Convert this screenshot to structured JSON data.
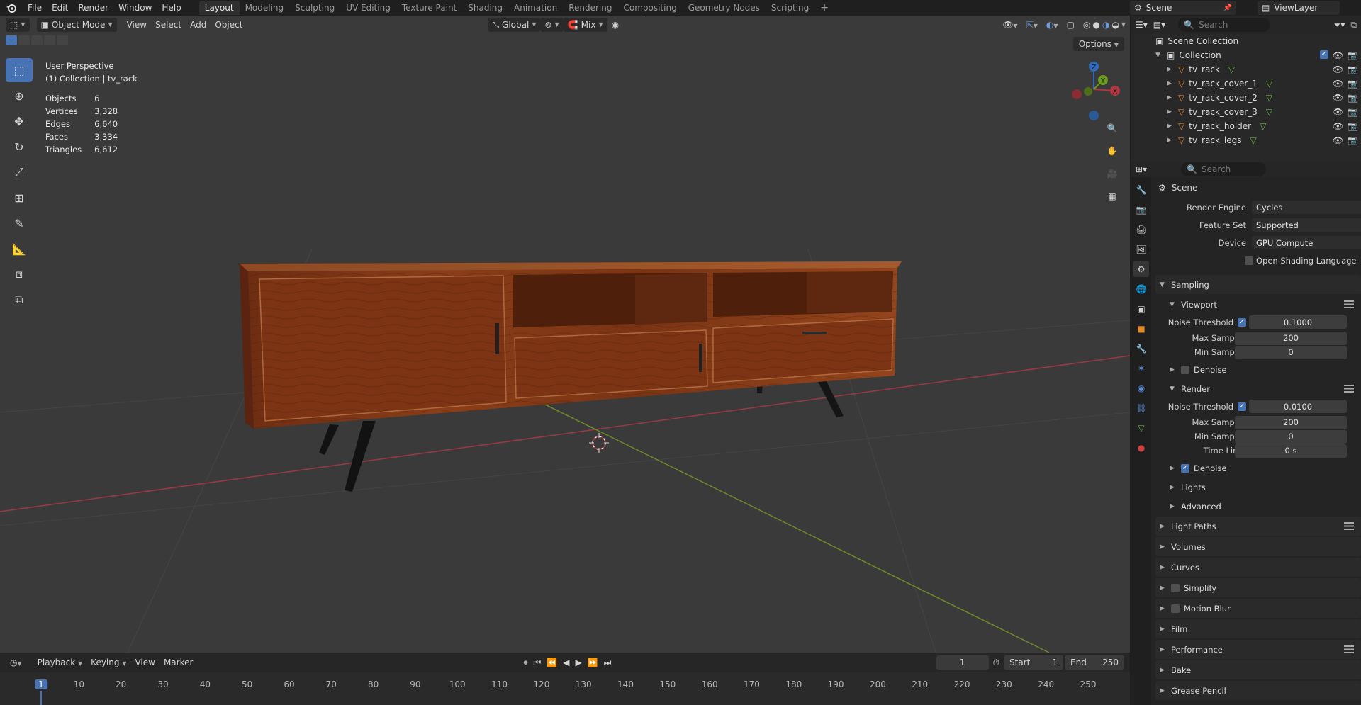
{
  "topbar": {
    "menus": [
      "File",
      "Edit",
      "Render",
      "Window",
      "Help"
    ],
    "workspaces": [
      "Layout",
      "Modeling",
      "Sculpting",
      "UV Editing",
      "Texture Paint",
      "Shading",
      "Animation",
      "Rendering",
      "Compositing",
      "Geometry Nodes",
      "Scripting"
    ],
    "active_workspace": "Layout",
    "add_workspace": "+",
    "scene_name": "Scene",
    "view_layer": "ViewLayer"
  },
  "viewport": {
    "mode": "Object Mode",
    "menus": [
      "View",
      "Select",
      "Add",
      "Object"
    ],
    "transform_orientation": "Global",
    "snap_mode": "Mix",
    "options_label": "Options",
    "perspective_label": "User Perspective",
    "collection_label": "(1) Collection | tv_rack",
    "stats": [
      {
        "label": "Objects",
        "value": "6"
      },
      {
        "label": "Vertices",
        "value": "3,328"
      },
      {
        "label": "Edges",
        "value": "6,640"
      },
      {
        "label": "Faces",
        "value": "3,334"
      },
      {
        "label": "Triangles",
        "value": "6,612"
      }
    ],
    "gizmo_axes": {
      "z": "Z",
      "y": "Y",
      "x": "X"
    },
    "colors": {
      "x_axis": "#9b3a44",
      "y_axis": "#6d8a2a",
      "bg": "#3a3a3a",
      "active_tool": "#4772b3"
    }
  },
  "timeline": {
    "menus": [
      "Playback",
      "Keying",
      "View",
      "Marker"
    ],
    "current_frame": "1",
    "start_label": "Start",
    "start_value": "1",
    "end_label": "End",
    "end_value": "250",
    "ticks": [
      "1",
      "10",
      "20",
      "30",
      "40",
      "50",
      "60",
      "70",
      "80",
      "90",
      "100",
      "110",
      "120",
      "130",
      "140",
      "150",
      "160",
      "170",
      "180",
      "190",
      "200",
      "210",
      "220",
      "230",
      "240",
      "250"
    ]
  },
  "outliner": {
    "search_placeholder": "Search",
    "scene_collection": "Scene Collection",
    "collection": "Collection",
    "objects": [
      "tv_rack",
      "tv_rack_cover_1",
      "tv_rack_cover_2",
      "tv_rack_cover_3",
      "tv_rack_holder",
      "tv_rack_legs"
    ]
  },
  "properties": {
    "search_placeholder": "Search",
    "context": "Scene",
    "render_engine_label": "Render Engine",
    "render_engine": "Cycles",
    "feature_set_label": "Feature Set",
    "feature_set": "Supported",
    "device_label": "Device",
    "device": "GPU Compute",
    "osl_label": "Open Shading Language",
    "sampling": {
      "title": "Sampling",
      "viewport": {
        "title": "Viewport",
        "noise_label": "Noise Threshold",
        "noise_value": "0.1000",
        "max_label": "Max Samples",
        "max_value": "200",
        "min_label": "Min Samples",
        "min_value": "0",
        "denoise_label": "Denoise"
      },
      "render": {
        "title": "Render",
        "noise_label": "Noise Threshold",
        "noise_value": "0.0100",
        "max_label": "Max Samples",
        "max_value": "200",
        "min_label": "Min Samples",
        "min_value": "0",
        "time_label": "Time Limit",
        "time_value": "0 s",
        "denoise_label": "Denoise"
      },
      "lights": "Lights",
      "advanced": "Advanced"
    },
    "panels": [
      "Light Paths",
      "Volumes",
      "Curves",
      "Simplify",
      "Motion Blur",
      "Film",
      "Performance",
      "Bake",
      "Grease Pencil"
    ]
  }
}
